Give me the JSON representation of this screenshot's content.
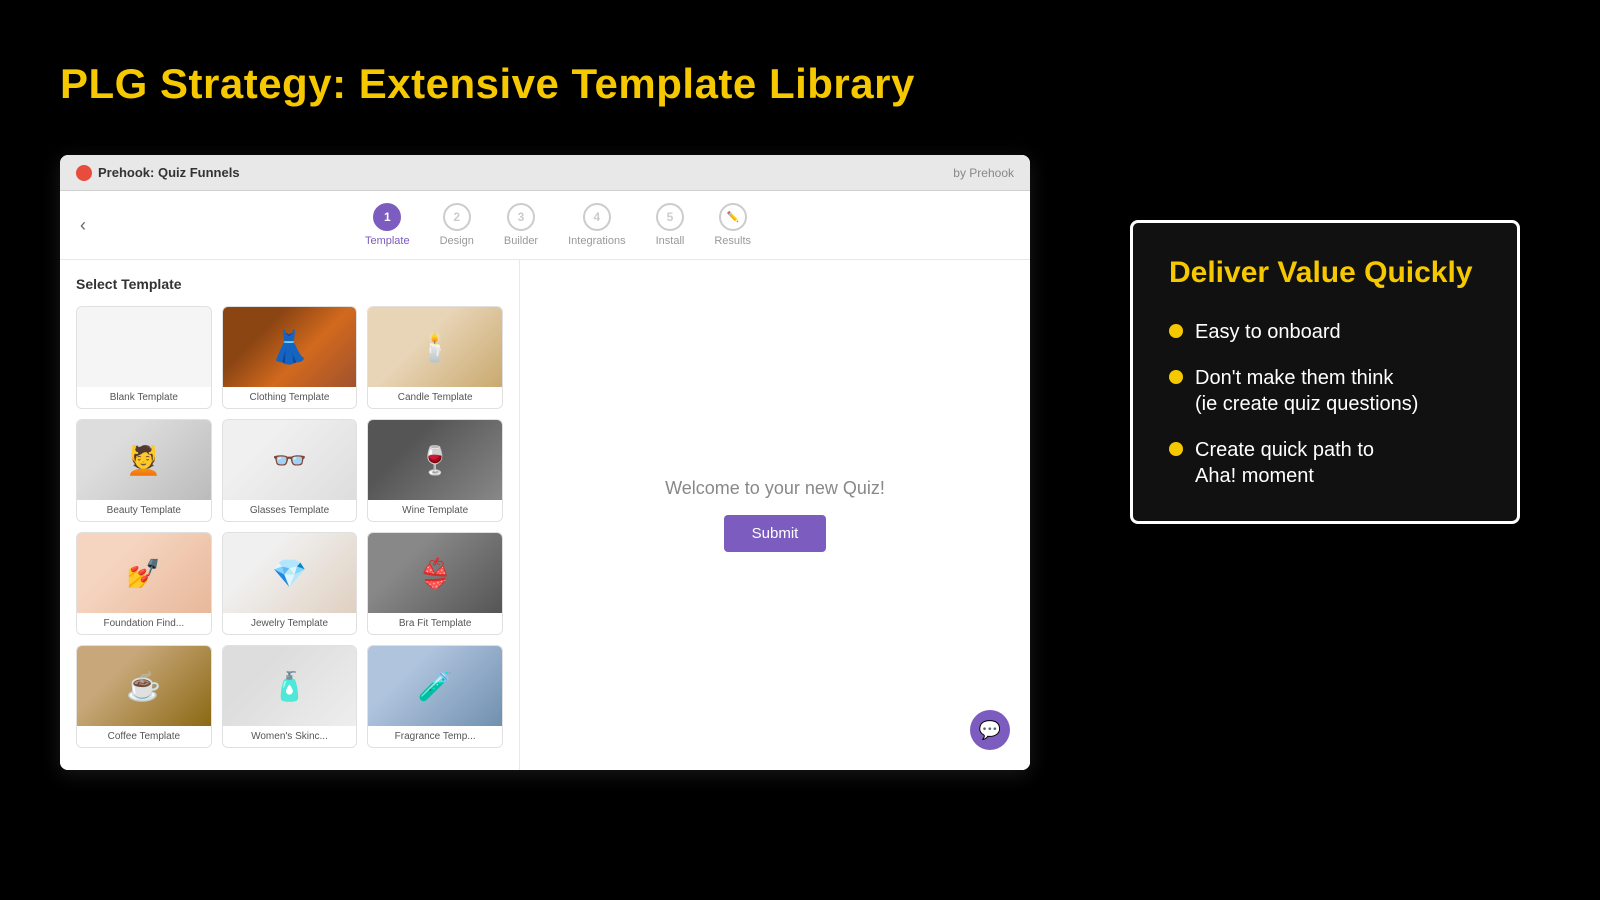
{
  "page": {
    "background": "#000000",
    "main_title": "PLG Strategy: Extensive Template Library"
  },
  "browser": {
    "app_name": "Prehook: Quiz Funnels",
    "brand": "by Prehook"
  },
  "steps": [
    {
      "number": "1",
      "label": "Template",
      "active": true
    },
    {
      "number": "2",
      "label": "Design",
      "active": false
    },
    {
      "number": "3",
      "label": "Builder",
      "active": false
    },
    {
      "number": "4",
      "label": "Integrations",
      "active": false
    },
    {
      "number": "5",
      "label": "Install",
      "active": false
    },
    {
      "icon": "edit",
      "label": "Results",
      "active": false
    }
  ],
  "sidebar": {
    "title": "Select Template",
    "templates": [
      {
        "name": "Blank Template",
        "type": "blank"
      },
      {
        "name": "Clothing Template",
        "type": "clothing"
      },
      {
        "name": "Candle Template",
        "type": "candle"
      },
      {
        "name": "Beauty Template",
        "type": "beauty"
      },
      {
        "name": "Glasses Template",
        "type": "glasses"
      },
      {
        "name": "Wine Template",
        "type": "wine"
      },
      {
        "name": "Foundation Find...",
        "type": "foundation"
      },
      {
        "name": "Jewelry Template",
        "type": "jewelry"
      },
      {
        "name": "Bra Fit Template",
        "type": "bra"
      },
      {
        "name": "Coffee Template",
        "type": "coffee"
      },
      {
        "name": "Women's Skinc...",
        "type": "womens"
      },
      {
        "name": "Fragrance Temp...",
        "type": "fragrance"
      }
    ]
  },
  "preview": {
    "welcome_text": "Welcome to your new Quiz!",
    "submit_label": "Submit"
  },
  "info_card": {
    "title": "Deliver Value Quickly",
    "bullets": [
      {
        "text": "Easy to onboard"
      },
      {
        "text": "Don't make them think\n(ie create quiz questions)"
      },
      {
        "text": "Create quick path to\nAha! moment"
      }
    ]
  }
}
